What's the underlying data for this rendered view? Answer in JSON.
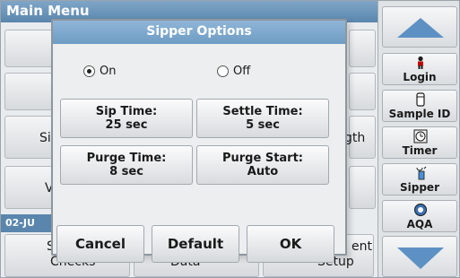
{
  "main": {
    "title": "Main Menu",
    "date": "02-JU",
    "partials": {
      "left_si": "Si",
      "left_v": "V",
      "left_s": "S",
      "left_checks": "Checks",
      "right_gth": "gth",
      "right_ent": "ent",
      "bottom_data": "Data",
      "bottom_setup": "Setup"
    }
  },
  "side_panel": {
    "buttons": [
      {
        "label": "Login",
        "icon": "person-icon"
      },
      {
        "label": "Sample ID",
        "icon": "sample-vial-icon"
      },
      {
        "label": "Timer",
        "icon": "timer-icon"
      },
      {
        "label": "Sipper",
        "icon": "sipper-icon"
      },
      {
        "label": "AQA",
        "icon": "aqa-icon"
      }
    ]
  },
  "dialog": {
    "title": "Sipper Options",
    "radio_on": "On",
    "radio_off": "Off",
    "selected": "On",
    "sip_time": {
      "label": "Sip Time:",
      "value": "25 sec"
    },
    "settle_time": {
      "label": "Settle Time:",
      "value": "5 sec"
    },
    "purge_time": {
      "label": "Purge Time:",
      "value": "8 sec"
    },
    "purge_start": {
      "label": "Purge Start:",
      "value": "Auto"
    },
    "cancel": "Cancel",
    "default": "Default",
    "ok": "OK"
  },
  "colors": {
    "title_bar": "#6e9cc3",
    "main_title_bar": "#5a86ad",
    "arrow": "#5d91c4"
  }
}
